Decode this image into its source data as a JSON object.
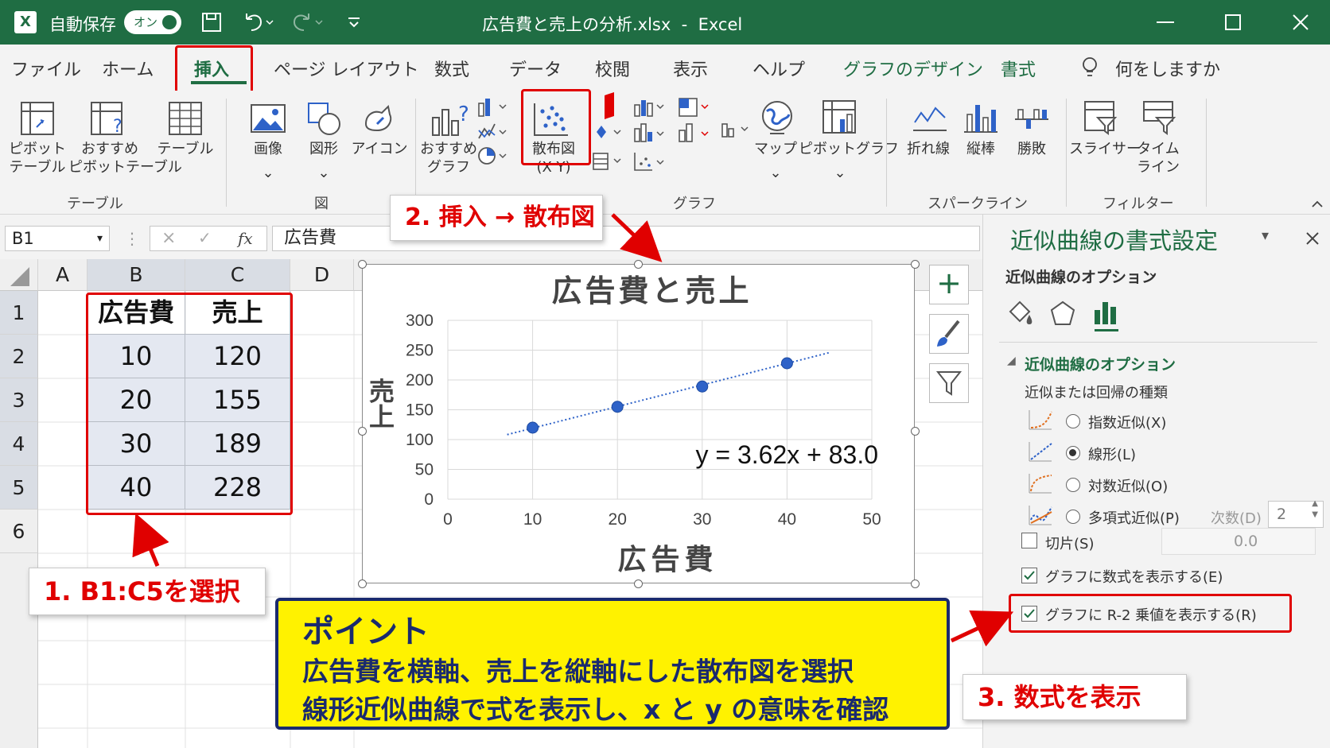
{
  "title_bar": {
    "autosave_label": "自動保存",
    "autosave_state": "オン",
    "filename": "広告費と売上の分析.xlsx",
    "separator": "-",
    "app_name": "Excel",
    "accent_color": "#1f6d43"
  },
  "tabs": [
    {
      "label": "ファイル"
    },
    {
      "label": "ホーム"
    },
    {
      "label": "挿入"
    },
    {
      "label": "ページ レイアウト"
    },
    {
      "label": "数式"
    },
    {
      "label": "データ"
    },
    {
      "label": "校閲"
    },
    {
      "label": "表示"
    },
    {
      "label": "ヘルプ"
    },
    {
      "label": "グラフのデザイン"
    },
    {
      "label": "書式"
    }
  ],
  "tell_me": "何をしますか",
  "ribbon": {
    "pivot_table": [
      "ピボット",
      "テーブル"
    ],
    "recommended_pivot": [
      "おすすめ",
      "ピボットテーブル"
    ],
    "table": "テーブル",
    "group_table": "テーブル",
    "image": "画像",
    "shapes": "図形",
    "icons": "アイコン",
    "group_figure": "図",
    "recommended_chart": [
      "おすすめ",
      "グラフ"
    ],
    "scatter": [
      "散布図",
      "(X Y)"
    ],
    "map": "マップ",
    "pivot_chart": "ピボットグラフ",
    "group_chart": "グラフ",
    "spark_line": "折れ線",
    "spark_column": "縦棒",
    "spark_winloss": "勝敗",
    "group_sparkline": "スパークライン",
    "slicer": "スライサー",
    "timeline": [
      "タイム",
      "ライン"
    ],
    "group_filter": "フィルター"
  },
  "formula_bar": {
    "name_box": "B1",
    "fx": "fx",
    "content": "広告費"
  },
  "grid": {
    "columns": [
      "A",
      "B",
      "C",
      "D"
    ],
    "rows": [
      "1",
      "2",
      "3",
      "4",
      "5",
      "6"
    ],
    "table": {
      "headers": [
        "広告費",
        "売上"
      ],
      "rows": [
        [
          "10",
          "120"
        ],
        [
          "20",
          "155"
        ],
        [
          "30",
          "189"
        ],
        [
          "40",
          "228"
        ]
      ]
    }
  },
  "chart_data": {
    "type": "scatter",
    "title": "広告費と売上",
    "xlabel": "広告費",
    "ylabel": "売上",
    "x": [
      10,
      20,
      30,
      40
    ],
    "y": [
      120,
      155,
      189,
      228
    ],
    "xlim": [
      0,
      50
    ],
    "ylim": [
      0,
      300
    ],
    "xticks": [
      "0",
      "10",
      "20",
      "30",
      "40",
      "50"
    ],
    "yticks": [
      "0",
      "50",
      "100",
      "150",
      "200",
      "250",
      "300"
    ],
    "trendline": {
      "type": "linear",
      "slope": 3.62,
      "intercept": 83.0,
      "x_range": [
        7,
        45
      ]
    },
    "equation": "y = 3.62x + 83.0",
    "grid": true,
    "point_color": "#2e62c8"
  },
  "side_buttons": {
    "add": "+"
  },
  "pane": {
    "title": "近似曲線の書式設定",
    "subtitle": "近似曲線のオプション",
    "section": "近似曲線のオプション",
    "type_label": "近似または回帰の種類",
    "options": [
      {
        "label": "指数近似(X)",
        "selected": false
      },
      {
        "label": "線形(L)",
        "selected": true
      },
      {
        "label": "対数近似(O)",
        "selected": false
      },
      {
        "label": "多項式近似(P)",
        "selected": false
      }
    ],
    "order_label": "次数(D)",
    "order_value": "2",
    "intercept_label": "切片(S)",
    "intercept_value": "0.0",
    "show_equation": "グラフに数式を表示する(E)",
    "show_equation_checked": true,
    "show_r2": "グラフに R-2 乗値を表示する(R)",
    "show_r2_checked": true
  },
  "annotations": {
    "step1": "1. B1:C5を選択",
    "step2": "2. 挿入 → 散布図",
    "step3": "3. 数式を表示",
    "point_title": "ポイント",
    "point_line1": "広告費を横軸、売上を縦軸にした散布図を選択",
    "point_line2": "線形近似曲線で式を表示し、x と y の意味を確認",
    "highlight_color": "#e00000",
    "box_color": "#fff200"
  }
}
